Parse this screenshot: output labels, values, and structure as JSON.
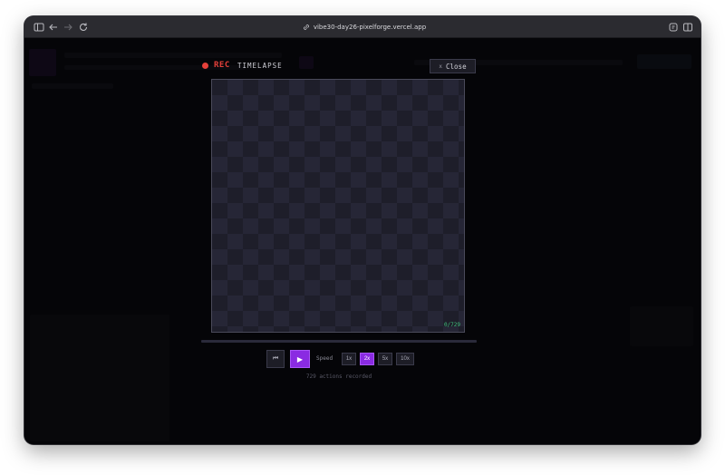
{
  "browser": {
    "url": "vibe30-day26-pixelforge.vercel.app",
    "icons": [
      "sidebar-icon",
      "back-arrow-icon",
      "forward-arrow-icon",
      "reload-icon",
      "link-icon",
      "extension-icon",
      "split-view-icon"
    ]
  },
  "modal": {
    "rec_label": "REC",
    "title": "TIMELAPSE",
    "close_x": "x",
    "close_label": "Close",
    "frame_counter": "0/729",
    "progress": 0,
    "speed_label": "Speed",
    "speeds": [
      "1x",
      "2x",
      "5x",
      "10x"
    ],
    "active_speed": "2x",
    "actions_recorded": "729 actions recorded"
  },
  "colors": {
    "rec": "#e5403a",
    "accent": "#8a2be2",
    "counter": "#3fbf7a"
  }
}
